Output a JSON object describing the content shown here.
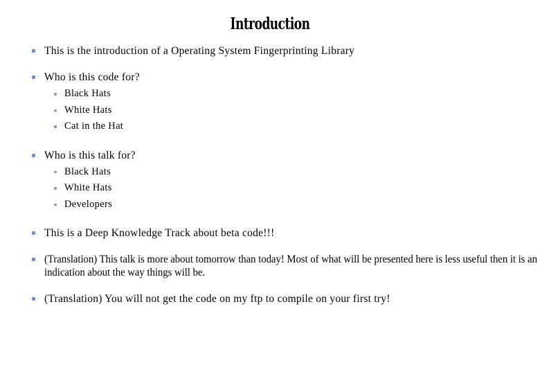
{
  "slide": {
    "title": "Introduction",
    "background_color": "#ffffff",
    "text_color": "#000000",
    "bullet_level1_color": "#7e92c2",
    "bullet_level2_color": "#8d9cbb",
    "bullets": [
      {
        "text": "This is the introduction of a Operating System Fingerprinting Library",
        "sub": []
      },
      {
        "text": "Who is this code for?",
        "sub": [
          "Black Hats",
          "White Hats",
          "Cat in the Hat"
        ]
      },
      {
        "text": "Who is this talk for?",
        "sub": [
          "Black Hats",
          "White Hats",
          "Developers"
        ]
      },
      {
        "text": "This is a Deep Knowledge Track about beta code!!!",
        "sub": []
      },
      {
        "text": "(Translation) This talk is more about tomorrow than today! Most of what will be presented here is less useful then it is an indication about the way things will be.",
        "sub": []
      },
      {
        "text": "(Translation) You will not get the code on my ftp to compile on your first try!",
        "sub": []
      }
    ]
  }
}
